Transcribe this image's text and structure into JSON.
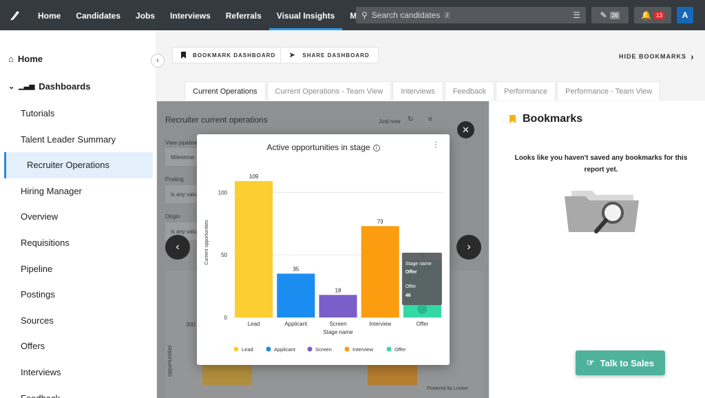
{
  "nav": {
    "items": [
      {
        "label": "Home",
        "active": false
      },
      {
        "label": "Candidates",
        "active": false
      },
      {
        "label": "Jobs",
        "active": false
      },
      {
        "label": "Interviews",
        "active": false
      },
      {
        "label": "Referrals",
        "active": false
      },
      {
        "label": "Visual Insights",
        "active": true
      },
      {
        "label": "More",
        "active": false
      }
    ],
    "search_placeholder": "Search candidates",
    "search_shortcut": "/",
    "edit_count": "26",
    "notification_count": "13",
    "avatar_initial": "A",
    "colors": {
      "bar": "#353a3e",
      "active_underline": "#2e9bf0",
      "badge": "#e02d2d"
    }
  },
  "sidebar": {
    "home": "Home",
    "dashboards": "Dashboards",
    "items": [
      {
        "label": "Tutorials"
      },
      {
        "label": "Talent Leader Summary"
      },
      {
        "label": "Recruiter Operations",
        "active": true
      },
      {
        "label": "Hiring Manager"
      },
      {
        "label": "Overview"
      },
      {
        "label": "Requisitions"
      },
      {
        "label": "Pipeline"
      },
      {
        "label": "Postings"
      },
      {
        "label": "Sources"
      },
      {
        "label": "Offers"
      },
      {
        "label": "Interviews"
      },
      {
        "label": "Feedback"
      }
    ]
  },
  "dashboard": {
    "bookmark_btn": "BOOKMARK DASHBOARD",
    "share_btn": "SHARE DASHBOARD",
    "hide_bookmarks": "HIDE BOOKMARKS",
    "tabs": [
      {
        "label": "Current Operations",
        "active": true
      },
      {
        "label": "Current Operations - Team View"
      },
      {
        "label": "Interviews"
      },
      {
        "label": "Feedback"
      },
      {
        "label": "Performance"
      },
      {
        "label": "Performance - Team View"
      }
    ],
    "section_title": "Recruiter current operations",
    "toolbar_text": "Just now",
    "filter_labels": [
      "View pipeline",
      "Milestone",
      "Posting",
      "is any value",
      "Origin",
      "is any value"
    ],
    "bg_chart_labels": [
      "300",
      "opportunities"
    ],
    "powered_by": "Powered by Looker"
  },
  "bookmarks": {
    "title": "Bookmarks",
    "empty_message": "Looks like you haven't saved any bookmarks for this report yet."
  },
  "talk_to_sales": "Talk to Sales",
  "modal": {
    "title": "Active opportunities in stage",
    "tooltip": {
      "label1": "Stage name",
      "value1": "Offer",
      "label2": "Offer",
      "value2": "46"
    }
  },
  "chart_data": {
    "type": "bar",
    "title": "Active opportunities in stage",
    "xlabel": "Stage name",
    "ylabel": "Current opportunities",
    "categories": [
      "Lead",
      "Applicant",
      "Screen",
      "Interview",
      "Offer"
    ],
    "values": [
      109,
      35,
      18,
      73,
      46
    ],
    "colors": [
      "#fbcf32",
      "#1b8df0",
      "#7b5fc9",
      "#fc9c0f",
      "#33d8a4"
    ],
    "ylim": [
      0,
      120
    ],
    "yticks": [
      0,
      50,
      100
    ],
    "legend": [
      "Lead",
      "Applicant",
      "Screen",
      "Interview",
      "Offer"
    ],
    "legend_position": "bottom",
    "grid": true
  }
}
